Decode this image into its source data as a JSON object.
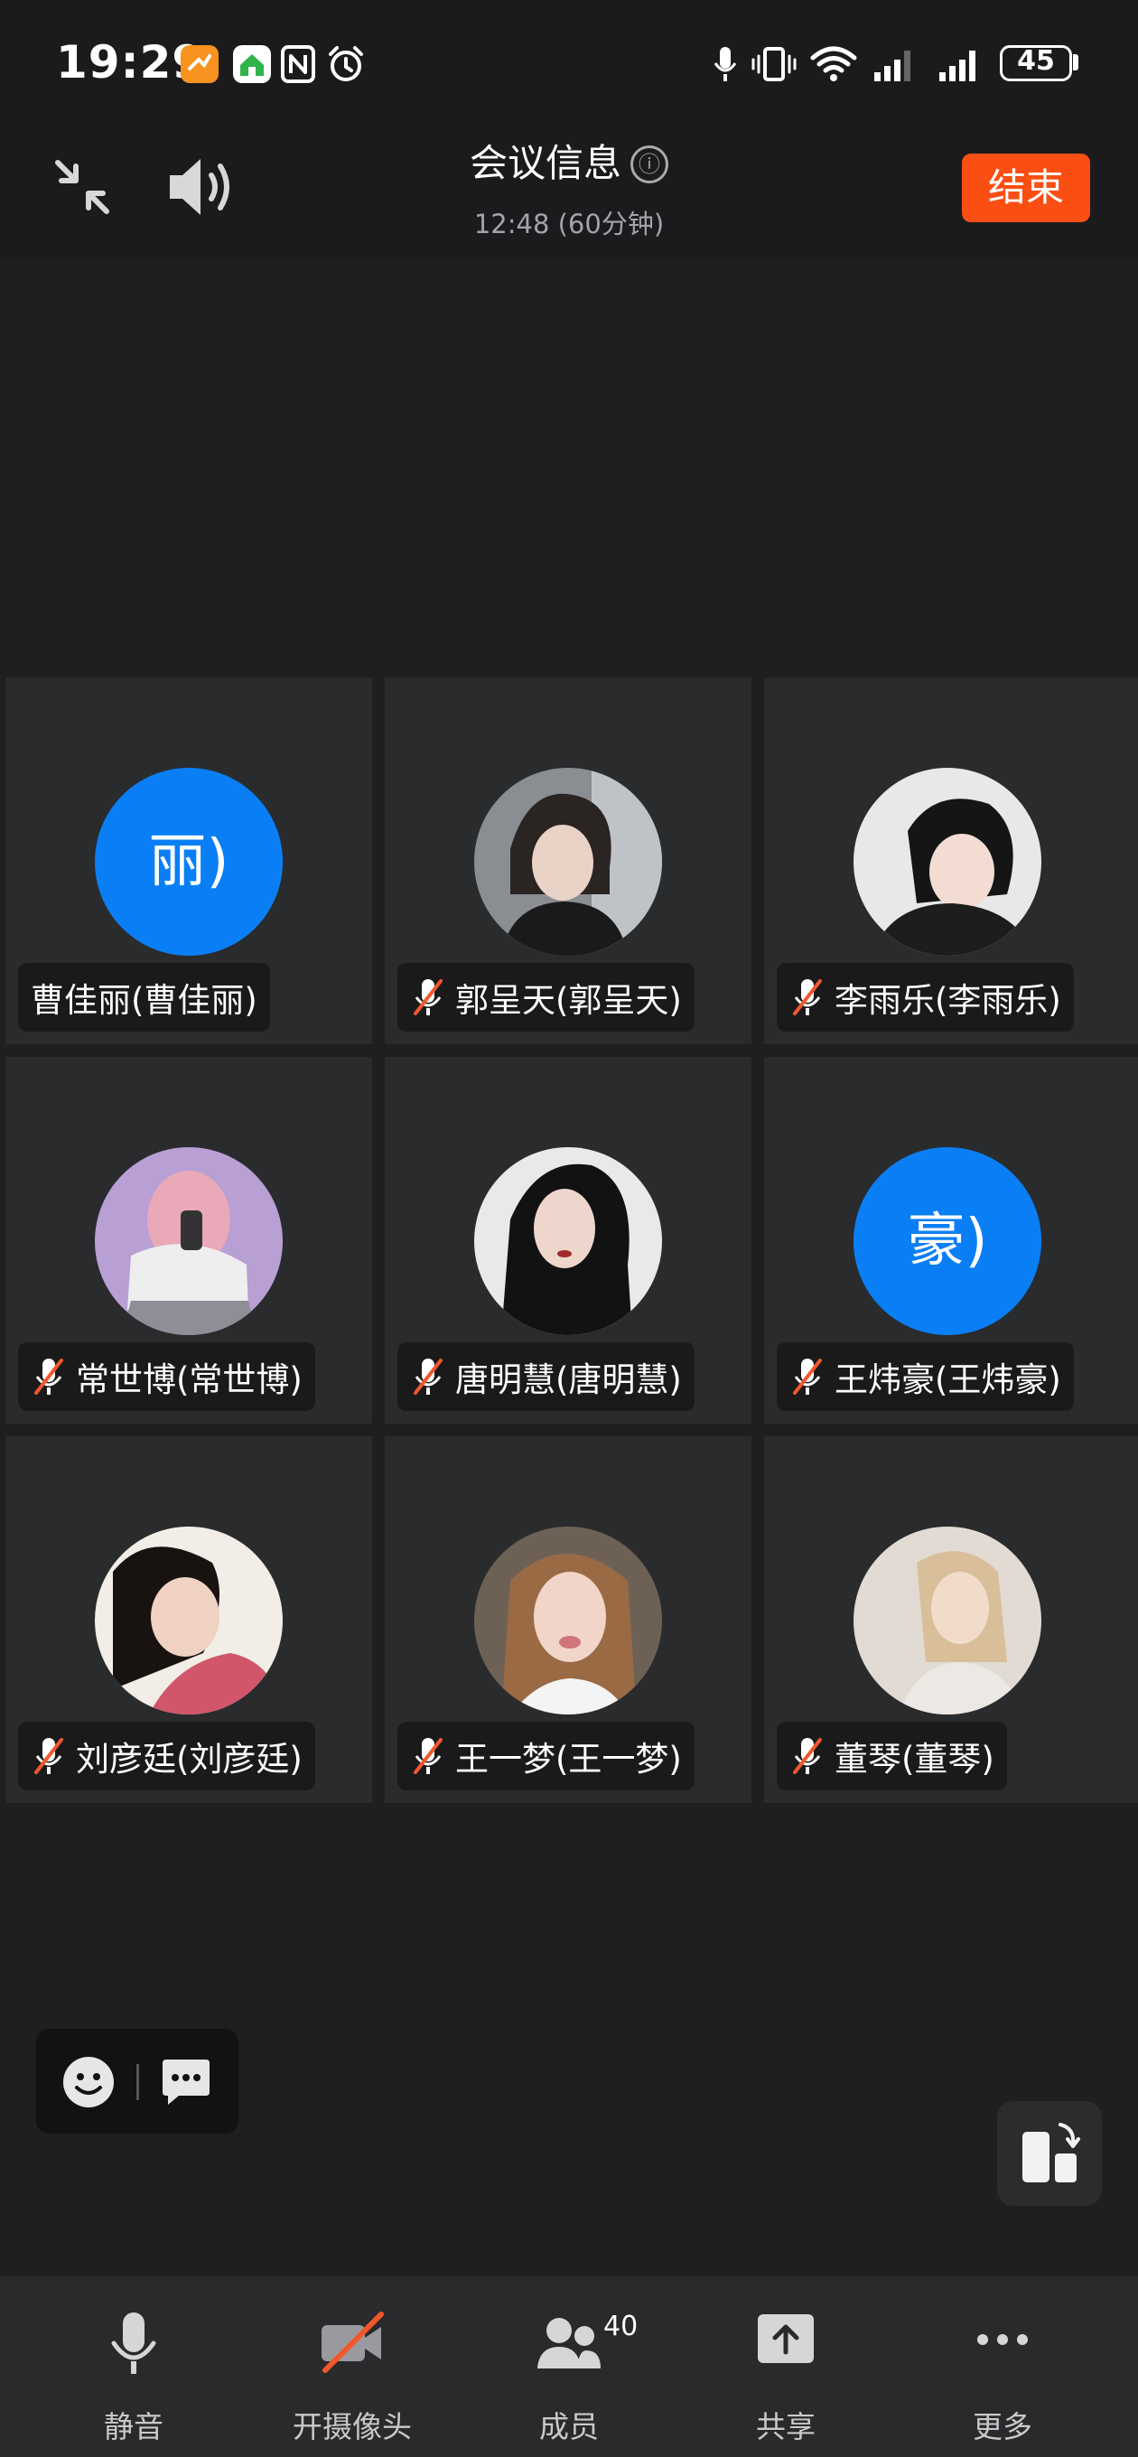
{
  "status_bar": {
    "time": "19:29",
    "battery": "45",
    "icons": [
      "app-icon-orange",
      "app-icon-home",
      "nfc-icon",
      "alarm-icon",
      "mic-icon",
      "vibrate-icon",
      "wifi-icon",
      "signal-icon",
      "signal-icon-2"
    ]
  },
  "header": {
    "title": "会议信息",
    "info_icon": "ⓘ",
    "subtitle": "12:48 (60分钟)",
    "end_label": "结束"
  },
  "participants": [
    {
      "name": "曹佳丽(曹佳丽)",
      "avatar_type": "letter",
      "avatar_text": "丽)",
      "muted": false
    },
    {
      "name": "郭呈天(郭呈天)",
      "avatar_type": "photo",
      "muted": true
    },
    {
      "name": "李雨乐(李雨乐)",
      "avatar_type": "photo",
      "muted": true
    },
    {
      "name": "常世博(常世博)",
      "avatar_type": "illustration",
      "muted": true
    },
    {
      "name": "唐明慧(唐明慧)",
      "avatar_type": "photo",
      "muted": true
    },
    {
      "name": "王炜豪(王炜豪)",
      "avatar_type": "letter",
      "avatar_text": "豪)",
      "muted": true
    },
    {
      "name": "刘彦廷(刘彦廷)",
      "avatar_type": "photo",
      "muted": true
    },
    {
      "name": "王一梦(王一梦)",
      "avatar_type": "photo",
      "muted": true
    },
    {
      "name": "董琴(董琴)",
      "avatar_type": "photo",
      "muted": true
    }
  ],
  "toolbar": {
    "mute_label": "静音",
    "camera_label": "开摄像头",
    "members_label": "成员",
    "members_count": "40",
    "share_label": "共享",
    "more_label": "更多"
  },
  "colors": {
    "accent_end": "#fa4e13",
    "avatar_blue": "#0a7ff5",
    "mute_slash": "#f0582b"
  }
}
